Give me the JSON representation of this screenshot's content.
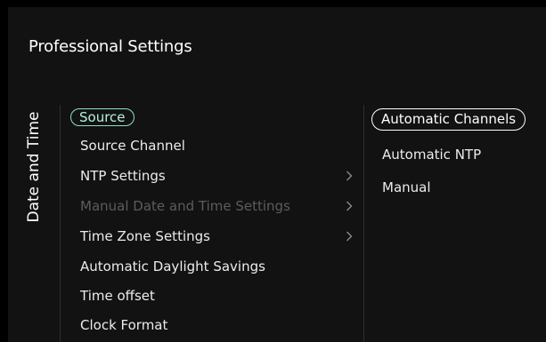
{
  "header": {
    "title": "Professional Settings"
  },
  "sidebar": {
    "category": "Date and Time"
  },
  "menu": {
    "items": [
      {
        "label": "Source",
        "state": "selected"
      },
      {
        "label": "Source Channel",
        "state": "normal"
      },
      {
        "label": "NTP Settings",
        "state": "normal",
        "submenu": true
      },
      {
        "label": "Manual Date and Time Settings",
        "state": "disabled",
        "submenu": true
      },
      {
        "label": "Time Zone Settings",
        "state": "normal",
        "submenu": true
      },
      {
        "label": "Automatic Daylight Savings",
        "state": "normal"
      },
      {
        "label": "Time offset",
        "state": "normal"
      },
      {
        "label": "Clock Format",
        "state": "normal"
      }
    ]
  },
  "options": {
    "items": [
      {
        "label": "Automatic Channels",
        "state": "focused"
      },
      {
        "label": "Automatic NTP",
        "state": "normal"
      },
      {
        "label": "Manual",
        "state": "normal"
      }
    ]
  },
  "icons": {
    "submenu": "chevron-right-icon"
  },
  "colors": {
    "background": "#121212",
    "selected_outline": "#8fe0c8",
    "focus_outline": "#ffffff",
    "text": "#ececec",
    "disabled_text": "#5c5c5c"
  }
}
